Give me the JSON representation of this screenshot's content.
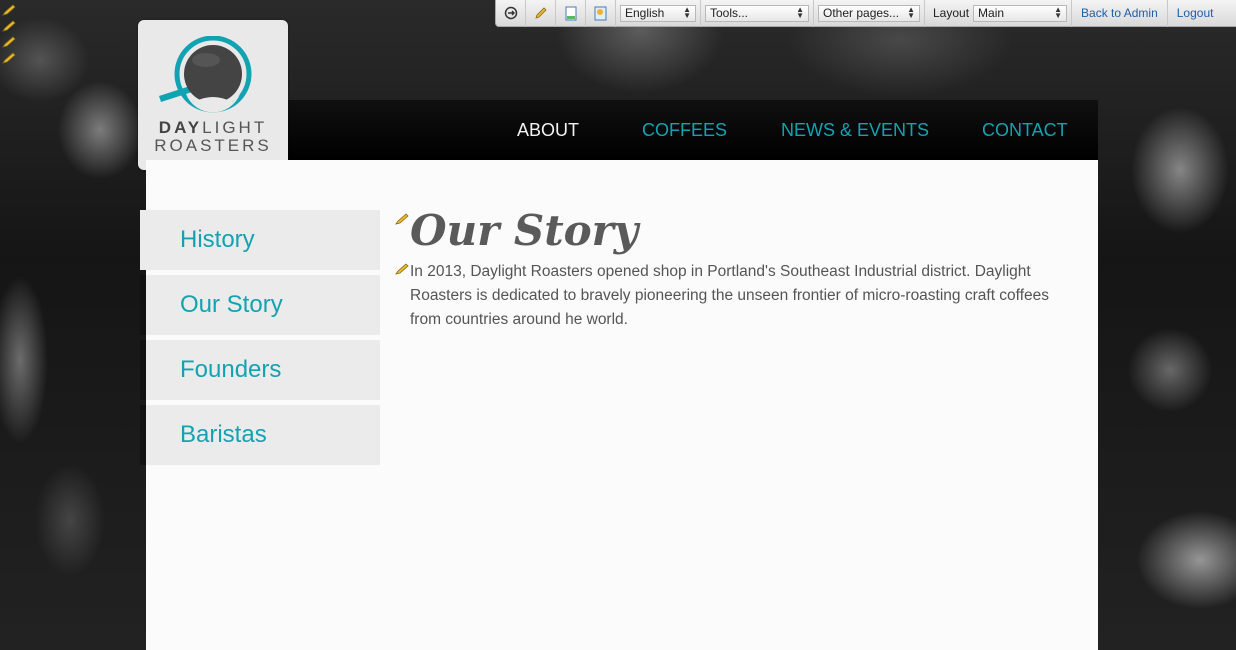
{
  "toolbar": {
    "language": "English",
    "tools": "Tools...",
    "other_pages": "Other pages...",
    "layout_label": "Layout",
    "layout_value": "Main",
    "back_to_admin": "Back to Admin",
    "logout": "Logout"
  },
  "logo": {
    "day": "DAY",
    "light": "LIGHT",
    "roasters": "ROASTERS"
  },
  "nav": {
    "items": [
      {
        "label": "ABOUT"
      },
      {
        "label": "COFFEES"
      },
      {
        "label": "NEWS & EVENTS"
      },
      {
        "label": "CONTACT"
      }
    ]
  },
  "sidebar": {
    "items": [
      {
        "label": "History"
      },
      {
        "label": "Our Story"
      },
      {
        "label": "Founders"
      },
      {
        "label": "Baristas"
      }
    ]
  },
  "content": {
    "title": "Our Story",
    "body": "In 2013, Daylight Roasters opened shop in Portland's Southeast Industrial district. Daylight Roasters is dedicated to bravely pioneering the unseen frontier of micro-roasting craft coffees from countries around he world."
  },
  "colors": {
    "accent": "#12a3b3",
    "nav_active": "#f2f2f2",
    "panel": "#fbfbfb"
  }
}
